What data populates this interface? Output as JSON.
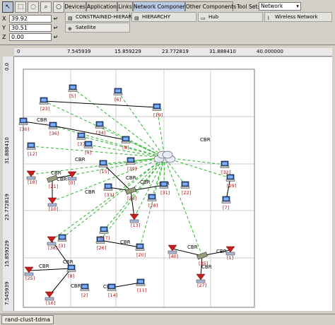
{
  "toolbar": {
    "tools": [
      "pointer-tool",
      "rect-select-tool",
      "lasso-select-tool",
      "zoom-tool",
      "ellipse-tool"
    ],
    "coords": [
      {
        "label": "X",
        "value": "39.92"
      },
      {
        "label": "Y",
        "value": "30.51"
      },
      {
        "label": "Z",
        "value": "0.00"
      }
    ],
    "tabs": [
      "Devices",
      "Applications",
      "Links",
      "Network Components",
      "Other Components"
    ],
    "active_tab": "Network Components",
    "toolset_label": "Tool Set:",
    "toolset_value": "Network",
    "palette": [
      {
        "label": "CONSTRAINED-HIERARCHY",
        "icon": "hierarchy-icon"
      },
      {
        "label": "HIERARCHY",
        "icon": "hierarchy-icon"
      },
      {
        "label": "Hub",
        "icon": "hub-icon"
      },
      {
        "label": "Wireless Network",
        "icon": "wireless-network-icon"
      },
      {
        "label": "Satellite",
        "icon": "satellite-icon"
      }
    ]
  },
  "ruler": {
    "top_ticks": [
      "0",
      "7.545939",
      "15.859229",
      "23.772819",
      "31.888410",
      "40.000000"
    ],
    "left_ticks": [
      "0.0",
      "7.545939",
      "15.859229",
      "23.772819",
      "31.888410"
    ]
  },
  "network": {
    "nodes": [
      {
        "id": "[5]",
        "type": "pc"
      },
      {
        "id": "[6]",
        "type": "pc"
      },
      {
        "id": "[19]",
        "type": "pc"
      },
      {
        "id": "[23]",
        "type": "pc"
      },
      {
        "id": "[30]",
        "type": "pc"
      },
      {
        "id": "[36]",
        "type": "pc"
      },
      {
        "id": "[34]",
        "type": "pc"
      },
      {
        "id": "[37]",
        "type": "pc"
      },
      {
        "id": "[9]",
        "type": "pc"
      },
      {
        "id": "[12]",
        "type": "pc"
      },
      {
        "id": "[4]",
        "type": "pc"
      },
      {
        "id": "[39]",
        "type": "pc"
      },
      {
        "id": "[32]",
        "type": "pc"
      },
      {
        "id": "[15]",
        "type": "pc"
      },
      {
        "id": "[29]",
        "type": "pc"
      },
      {
        "id": "[7]",
        "type": "pc"
      },
      {
        "id": "[22]",
        "type": "pc"
      },
      {
        "id": "[31]",
        "type": "pc"
      },
      {
        "id": "[28]",
        "type": "pc"
      },
      {
        "id": "[33]",
        "type": "pc"
      },
      {
        "id": "[14]",
        "type": "pc"
      },
      {
        "id": "[11]",
        "type": "pc"
      },
      {
        "id": "[20]",
        "type": "pc"
      },
      {
        "id": "[26]",
        "type": "pc"
      },
      {
        "id": "[17]",
        "type": "pc"
      },
      {
        "id": "[2]",
        "type": "pc"
      },
      {
        "id": "[3]",
        "type": "pc"
      },
      {
        "id": "[8]",
        "type": "pc"
      },
      {
        "id": "[21]",
        "type": "switch"
      },
      {
        "id": "[24]",
        "type": "switch"
      },
      {
        "id": "[35]",
        "type": "switch"
      },
      {
        "id": "[18]",
        "type": "router"
      },
      {
        "id": "[10]",
        "type": "router"
      },
      {
        "id": "[13]",
        "type": "router"
      },
      {
        "id": "[38]",
        "type": "router"
      },
      {
        "id": "[25]",
        "type": "router"
      },
      {
        "id": "[16]",
        "type": "router"
      },
      {
        "id": "[27]",
        "type": "router"
      },
      {
        "id": "[40]",
        "type": "router"
      },
      {
        "id": "[1]",
        "type": "router"
      },
      {
        "id": "[0]",
        "type": "router"
      }
    ],
    "link_label": "CBR"
  },
  "status": {
    "tab": "rand-clust-tdma"
  }
}
